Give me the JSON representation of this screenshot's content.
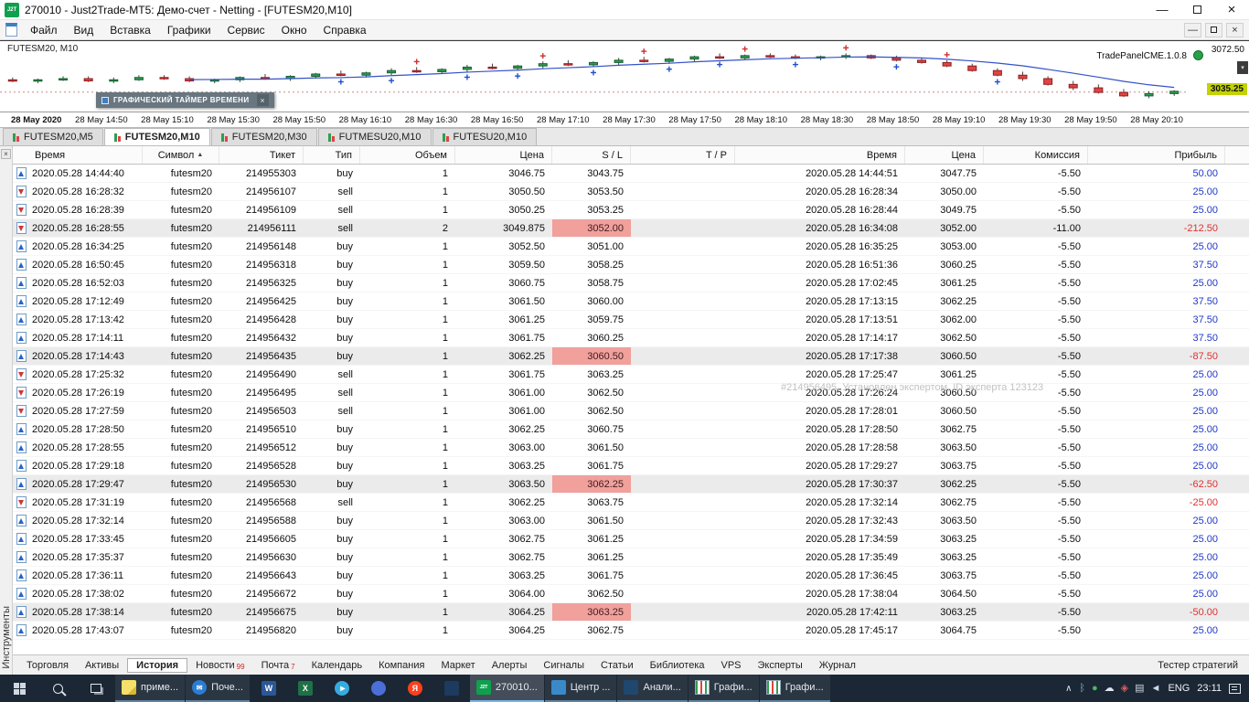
{
  "glyphs": {
    "minimize": "—",
    "close": "×",
    "chevron": "∧",
    "corner_arrow": "▾"
  },
  "titlebar": {
    "icon_text": "J2T",
    "title": "270010 - Just2Trade-MT5: Демо-счет - Netting - [FUTESM20,M10]"
  },
  "menu": {
    "items": [
      "Файл",
      "Вид",
      "Вставка",
      "Графики",
      "Сервис",
      "Окно",
      "Справка"
    ]
  },
  "chart": {
    "symbol_label": "FUTESM20, M10",
    "trade_panel_label": "TradePanelCME.1.0.8",
    "price_axis_top": "3072.50",
    "price_current": "3035.25",
    "timer_overlay_title": "ГРАФИЧЕСКИЙ ТАЙМЕР ВРЕМЕНИ"
  },
  "chart_data": {
    "type": "candlestick",
    "title": "FUTESM20, M10",
    "timeframe": "M10",
    "ylim": [
      3020,
      3078
    ],
    "current_price": 3035.25,
    "visible_axis_prices": [
      3072.5,
      3035.25
    ],
    "ma_period": 8,
    "x_labels": [
      "28 May 2020",
      "28 May 14:50",
      "28 May 15:10",
      "28 May 15:30",
      "28 May 15:50",
      "28 May 16:10",
      "28 May 16:30",
      "28 May 16:50",
      "28 May 17:10",
      "28 May 17:30",
      "28 May 17:50",
      "28 May 18:10",
      "28 May 18:30",
      "28 May 18:50",
      "28 May 19:10",
      "28 May 19:30",
      "28 May 19:50",
      "28 May 20:10"
    ],
    "candles": [
      [
        3046,
        3048,
        3044,
        3045
      ],
      [
        3045,
        3047,
        3043,
        3046
      ],
      [
        3046,
        3049,
        3045,
        3047
      ],
      [
        3047,
        3049,
        3044,
        3045
      ],
      [
        3045,
        3048,
        3043,
        3046
      ],
      [
        3046,
        3050,
        3045,
        3048
      ],
      [
        3048,
        3050,
        3046,
        3047
      ],
      [
        3047,
        3049,
        3044,
        3045
      ],
      [
        3045,
        3047,
        3043,
        3046
      ],
      [
        3046,
        3049,
        3044,
        3048
      ],
      [
        3048,
        3051,
        3046,
        3047
      ],
      [
        3047,
        3050,
        3045,
        3049
      ],
      [
        3049,
        3052,
        3047,
        3051
      ],
      [
        3051,
        3054,
        3049,
        3050
      ],
      [
        3050,
        3053,
        3048,
        3052
      ],
      [
        3052,
        3056,
        3050,
        3054
      ],
      [
        3054,
        3057,
        3052,
        3053
      ],
      [
        3053,
        3056,
        3051,
        3055
      ],
      [
        3055,
        3059,
        3053,
        3057
      ],
      [
        3057,
        3060,
        3055,
        3056
      ],
      [
        3056,
        3059,
        3054,
        3058
      ],
      [
        3058,
        3062,
        3056,
        3060
      ],
      [
        3060,
        3063,
        3058,
        3059
      ],
      [
        3059,
        3062,
        3057,
        3061
      ],
      [
        3061,
        3065,
        3059,
        3063
      ],
      [
        3063,
        3066,
        3061,
        3062
      ],
      [
        3062,
        3065,
        3060,
        3064
      ],
      [
        3064,
        3067,
        3062,
        3066
      ],
      [
        3066,
        3069,
        3064,
        3065
      ],
      [
        3065,
        3068,
        3063,
        3067
      ],
      [
        3067,
        3069,
        3065,
        3066
      ],
      [
        3066,
        3068,
        3064,
        3065
      ],
      [
        3065,
        3067,
        3063,
        3066
      ],
      [
        3066,
        3069,
        3064,
        3067
      ],
      [
        3067,
        3068,
        3064,
        3065
      ],
      [
        3065,
        3067,
        3062,
        3063
      ],
      [
        3063,
        3065,
        3060,
        3061
      ],
      [
        3061,
        3063,
        3057,
        3058
      ],
      [
        3058,
        3060,
        3053,
        3054
      ],
      [
        3054,
        3056,
        3049,
        3050
      ],
      [
        3050,
        3053,
        3045,
        3047
      ],
      [
        3047,
        3049,
        3041,
        3042
      ],
      [
        3042,
        3045,
        3037,
        3039
      ],
      [
        3039,
        3042,
        3034,
        3035
      ],
      [
        3035,
        3038,
        3031,
        3032
      ],
      [
        3032,
        3036,
        3030,
        3034
      ],
      [
        3034,
        3037,
        3032,
        3036
      ]
    ],
    "trade_markers": [
      {
        "i": 13,
        "pos": "below",
        "color": "#2050d0"
      },
      {
        "i": 15,
        "pos": "below",
        "color": "#2050d0"
      },
      {
        "i": 16,
        "pos": "above",
        "color": "#d03030"
      },
      {
        "i": 18,
        "pos": "below",
        "color": "#2050d0"
      },
      {
        "i": 20,
        "pos": "below",
        "color": "#2050d0"
      },
      {
        "i": 21,
        "pos": "above",
        "color": "#d03030"
      },
      {
        "i": 23,
        "pos": "below",
        "color": "#2050d0"
      },
      {
        "i": 25,
        "pos": "above",
        "color": "#d03030"
      },
      {
        "i": 26,
        "pos": "below",
        "color": "#2050d0"
      },
      {
        "i": 28,
        "pos": "below",
        "color": "#2050d0"
      },
      {
        "i": 29,
        "pos": "above",
        "color": "#d03030"
      },
      {
        "i": 31,
        "pos": "below",
        "color": "#2050d0"
      },
      {
        "i": 33,
        "pos": "above",
        "color": "#d03030"
      },
      {
        "i": 35,
        "pos": "below",
        "color": "#2050d0"
      },
      {
        "i": 37,
        "pos": "above",
        "color": "#d03030"
      },
      {
        "i": 39,
        "pos": "below",
        "color": "#2050d0"
      }
    ],
    "colors": {
      "up": "#2e9e52",
      "down": "#e14343",
      "ma_line": "#3452c8"
    }
  },
  "chart_tabs": [
    {
      "label": "FUTESM20,M5",
      "active": false
    },
    {
      "label": "FUTESM20,M10",
      "active": true
    },
    {
      "label": "FUTESM20,M30",
      "active": false
    },
    {
      "label": "FUTMESU20,M10",
      "active": false
    },
    {
      "label": "FUTESU20,M10",
      "active": false
    }
  ],
  "toolbox": {
    "side_label": "Инструменты",
    "right_label": "Тестер стратегий",
    "watermark": "#214956495, Установлен экспертом, ID эксперта 123123",
    "sort_arrow": "▲",
    "columns": [
      "Время",
      "Символ",
      "Тикет",
      "Тип",
      "Объем",
      "Цена",
      "S / L",
      "T / P",
      "Время",
      "Цена",
      "Комиссия",
      "Прибыль"
    ],
    "rows": [
      {
        "t1": "2020.05.28 14:44:40",
        "sym": "futesm20",
        "ticket": "214955303",
        "type": "buy",
        "vol": "1",
        "price": "3046.75",
        "sl": "3043.75",
        "tp": "",
        "t2": "2020.05.28 14:44:51",
        "price2": "3047.75",
        "comm": "-5.50",
        "profit": "50.00",
        "sl_hit": false
      },
      {
        "t1": "2020.05.28 16:28:32",
        "sym": "futesm20",
        "ticket": "214956107",
        "type": "sell",
        "vol": "1",
        "price": "3050.50",
        "sl": "3053.50",
        "tp": "",
        "t2": "2020.05.28 16:28:34",
        "price2": "3050.00",
        "comm": "-5.50",
        "profit": "25.00",
        "sl_hit": false
      },
      {
        "t1": "2020.05.28 16:28:39",
        "sym": "futesm20",
        "ticket": "214956109",
        "type": "sell",
        "vol": "1",
        "price": "3050.25",
        "sl": "3053.25",
        "tp": "",
        "t2": "2020.05.28 16:28:44",
        "price2": "3049.75",
        "comm": "-5.50",
        "profit": "25.00",
        "sl_hit": false
      },
      {
        "t1": "2020.05.28 16:28:55",
        "sym": "futesm20",
        "ticket": "214956111",
        "type": "sell",
        "vol": "2",
        "price": "3049.875",
        "sl": "3052.00",
        "tp": "",
        "t2": "2020.05.28 16:34:08",
        "price2": "3052.00",
        "comm": "-11.00",
        "profit": "-212.50",
        "sl_hit": true
      },
      {
        "t1": "2020.05.28 16:34:25",
        "sym": "futesm20",
        "ticket": "214956148",
        "type": "buy",
        "vol": "1",
        "price": "3052.50",
        "sl": "3051.00",
        "tp": "",
        "t2": "2020.05.28 16:35:25",
        "price2": "3053.00",
        "comm": "-5.50",
        "profit": "25.00",
        "sl_hit": false
      },
      {
        "t1": "2020.05.28 16:50:45",
        "sym": "futesm20",
        "ticket": "214956318",
        "type": "buy",
        "vol": "1",
        "price": "3059.50",
        "sl": "3058.25",
        "tp": "",
        "t2": "2020.05.28 16:51:36",
        "price2": "3060.25",
        "comm": "-5.50",
        "profit": "37.50",
        "sl_hit": false
      },
      {
        "t1": "2020.05.28 16:52:03",
        "sym": "futesm20",
        "ticket": "214956325",
        "type": "buy",
        "vol": "1",
        "price": "3060.75",
        "sl": "3058.75",
        "tp": "",
        "t2": "2020.05.28 17:02:45",
        "price2": "3061.25",
        "comm": "-5.50",
        "profit": "25.00",
        "sl_hit": false
      },
      {
        "t1": "2020.05.28 17:12:49",
        "sym": "futesm20",
        "ticket": "214956425",
        "type": "buy",
        "vol": "1",
        "price": "3061.50",
        "sl": "3060.00",
        "tp": "",
        "t2": "2020.05.28 17:13:15",
        "price2": "3062.25",
        "comm": "-5.50",
        "profit": "37.50",
        "sl_hit": false
      },
      {
        "t1": "2020.05.28 17:13:42",
        "sym": "futesm20",
        "ticket": "214956428",
        "type": "buy",
        "vol": "1",
        "price": "3061.25",
        "sl": "3059.75",
        "tp": "",
        "t2": "2020.05.28 17:13:51",
        "price2": "3062.00",
        "comm": "-5.50",
        "profit": "37.50",
        "sl_hit": false
      },
      {
        "t1": "2020.05.28 17:14:11",
        "sym": "futesm20",
        "ticket": "214956432",
        "type": "buy",
        "vol": "1",
        "price": "3061.75",
        "sl": "3060.25",
        "tp": "",
        "t2": "2020.05.28 17:14:17",
        "price2": "3062.50",
        "comm": "-5.50",
        "profit": "37.50",
        "sl_hit": false
      },
      {
        "t1": "2020.05.28 17:14:43",
        "sym": "futesm20",
        "ticket": "214956435",
        "type": "buy",
        "vol": "1",
        "price": "3062.25",
        "sl": "3060.50",
        "tp": "",
        "t2": "2020.05.28 17:17:38",
        "price2": "3060.50",
        "comm": "-5.50",
        "profit": "-87.50",
        "sl_hit": true
      },
      {
        "t1": "2020.05.28 17:25:32",
        "sym": "futesm20",
        "ticket": "214956490",
        "type": "sell",
        "vol": "1",
        "price": "3061.75",
        "sl": "3063.25",
        "tp": "",
        "t2": "2020.05.28 17:25:47",
        "price2": "3061.25",
        "comm": "-5.50",
        "profit": "25.00",
        "sl_hit": false
      },
      {
        "t1": "2020.05.28 17:26:19",
        "sym": "futesm20",
        "ticket": "214956495",
        "type": "sell",
        "vol": "1",
        "price": "3061.00",
        "sl": "3062.50",
        "tp": "",
        "t2": "2020.05.28 17:26:24",
        "price2": "3060.50",
        "comm": "-5.50",
        "profit": "25.00",
        "sl_hit": false
      },
      {
        "t1": "2020.05.28 17:27:59",
        "sym": "futesm20",
        "ticket": "214956503",
        "type": "sell",
        "vol": "1",
        "price": "3061.00",
        "sl": "3062.50",
        "tp": "",
        "t2": "2020.05.28 17:28:01",
        "price2": "3060.50",
        "comm": "-5.50",
        "profit": "25.00",
        "sl_hit": false
      },
      {
        "t1": "2020.05.28 17:28:50",
        "sym": "futesm20",
        "ticket": "214956510",
        "type": "buy",
        "vol": "1",
        "price": "3062.25",
        "sl": "3060.75",
        "tp": "",
        "t2": "2020.05.28 17:28:50",
        "price2": "3062.75",
        "comm": "-5.50",
        "profit": "25.00",
        "sl_hit": false
      },
      {
        "t1": "2020.05.28 17:28:55",
        "sym": "futesm20",
        "ticket": "214956512",
        "type": "buy",
        "vol": "1",
        "price": "3063.00",
        "sl": "3061.50",
        "tp": "",
        "t2": "2020.05.28 17:28:58",
        "price2": "3063.50",
        "comm": "-5.50",
        "profit": "25.00",
        "sl_hit": false
      },
      {
        "t1": "2020.05.28 17:29:18",
        "sym": "futesm20",
        "ticket": "214956528",
        "type": "buy",
        "vol": "1",
        "price": "3063.25",
        "sl": "3061.75",
        "tp": "",
        "t2": "2020.05.28 17:29:27",
        "price2": "3063.75",
        "comm": "-5.50",
        "profit": "25.00",
        "sl_hit": false
      },
      {
        "t1": "2020.05.28 17:29:47",
        "sym": "futesm20",
        "ticket": "214956530",
        "type": "buy",
        "vol": "1",
        "price": "3063.50",
        "sl": "3062.25",
        "tp": "",
        "t2": "2020.05.28 17:30:37",
        "price2": "3062.25",
        "comm": "-5.50",
        "profit": "-62.50",
        "sl_hit": true
      },
      {
        "t1": "2020.05.28 17:31:19",
        "sym": "futesm20",
        "ticket": "214956568",
        "type": "sell",
        "vol": "1",
        "price": "3062.25",
        "sl": "3063.75",
        "tp": "",
        "t2": "2020.05.28 17:32:14",
        "price2": "3062.75",
        "comm": "-5.50",
        "profit": "-25.00",
        "sl_hit": false
      },
      {
        "t1": "2020.05.28 17:32:14",
        "sym": "futesm20",
        "ticket": "214956588",
        "type": "buy",
        "vol": "1",
        "price": "3063.00",
        "sl": "3061.50",
        "tp": "",
        "t2": "2020.05.28 17:32:43",
        "price2": "3063.50",
        "comm": "-5.50",
        "profit": "25.00",
        "sl_hit": false
      },
      {
        "t1": "2020.05.28 17:33:45",
        "sym": "futesm20",
        "ticket": "214956605",
        "type": "buy",
        "vol": "1",
        "price": "3062.75",
        "sl": "3061.25",
        "tp": "",
        "t2": "2020.05.28 17:34:59",
        "price2": "3063.25",
        "comm": "-5.50",
        "profit": "25.00",
        "sl_hit": false
      },
      {
        "t1": "2020.05.28 17:35:37",
        "sym": "futesm20",
        "ticket": "214956630",
        "type": "buy",
        "vol": "1",
        "price": "3062.75",
        "sl": "3061.25",
        "tp": "",
        "t2": "2020.05.28 17:35:49",
        "price2": "3063.25",
        "comm": "-5.50",
        "profit": "25.00",
        "sl_hit": false
      },
      {
        "t1": "2020.05.28 17:36:11",
        "sym": "futesm20",
        "ticket": "214956643",
        "type": "buy",
        "vol": "1",
        "price": "3063.25",
        "sl": "3061.75",
        "tp": "",
        "t2": "2020.05.28 17:36:45",
        "price2": "3063.75",
        "comm": "-5.50",
        "profit": "25.00",
        "sl_hit": false
      },
      {
        "t1": "2020.05.28 17:38:02",
        "sym": "futesm20",
        "ticket": "214956672",
        "type": "buy",
        "vol": "1",
        "price": "3064.00",
        "sl": "3062.50",
        "tp": "",
        "t2": "2020.05.28 17:38:04",
        "price2": "3064.50",
        "comm": "-5.50",
        "profit": "25.00",
        "sl_hit": false
      },
      {
        "t1": "2020.05.28 17:38:14",
        "sym": "futesm20",
        "ticket": "214956675",
        "type": "buy",
        "vol": "1",
        "price": "3064.25",
        "sl": "3063.25",
        "tp": "",
        "t2": "2020.05.28 17:42:11",
        "price2": "3063.25",
        "comm": "-5.50",
        "profit": "-50.00",
        "sl_hit": true
      },
      {
        "t1": "2020.05.28 17:43:07",
        "sym": "futesm20",
        "ticket": "214956820",
        "type": "buy",
        "vol": "1",
        "price": "3064.25",
        "sl": "3062.75",
        "tp": "",
        "t2": "2020.05.28 17:45:17",
        "price2": "3064.75",
        "comm": "-5.50",
        "profit": "25.00",
        "sl_hit": false
      }
    ],
    "tabs": [
      {
        "label": "Торговля"
      },
      {
        "label": "Активы"
      },
      {
        "label": "История",
        "active": true
      },
      {
        "label": "Новости",
        "badge": "99"
      },
      {
        "label": "Почта",
        "badge": "7"
      },
      {
        "label": "Календарь"
      },
      {
        "label": "Компания"
      },
      {
        "label": "Маркет"
      },
      {
        "label": "Алерты"
      },
      {
        "label": "Сигналы"
      },
      {
        "label": "Статьи"
      },
      {
        "label": "Библиотека"
      },
      {
        "label": "VPS"
      },
      {
        "label": "Эксперты"
      },
      {
        "label": "Журнал"
      }
    ]
  },
  "taskbar": {
    "items": [
      {
        "icon": "sticky",
        "label": "приме...",
        "window": true
      },
      {
        "icon": "mail",
        "glyph": "✉",
        "label": "Поче...",
        "window": true
      },
      {
        "icon": "word",
        "glyph": "W"
      },
      {
        "icon": "excel",
        "glyph": "X"
      },
      {
        "icon": "telegram",
        "glyph": "▸"
      },
      {
        "icon": "app-blue",
        "glyph": ""
      },
      {
        "icon": "yandex",
        "glyph": "Я"
      },
      {
        "icon": "app-dark",
        "glyph": ""
      },
      {
        "icon": "j2t",
        "glyph": "J2T",
        "label": "270010...",
        "window": true,
        "active": true
      },
      {
        "icon": "center",
        "glyph": "",
        " label": "",
        "label": "Центр ...",
        "window": true
      },
      {
        "icon": "analytics",
        "glyph": "",
        "label": "Анали...",
        "window": true
      },
      {
        "icon": "chart",
        "glyph": "",
        "label": "Графи...",
        "window": true
      },
      {
        "icon": "chart",
        "glyph": "",
        "label": "Графи...",
        "window": true
      }
    ],
    "tray": {
      "chevron": "∧",
      "icons": [
        {
          "glyph": "ᛒ",
          "color": "#7fb4e8"
        },
        {
          "glyph": "●",
          "color": "#49b860"
        },
        {
          "glyph": "☁",
          "color": "#dfe6ec"
        },
        {
          "glyph": "◈",
          "color": "#e25b5b"
        },
        {
          "glyph": "▤",
          "color": "#cfd8e0"
        },
        {
          "glyph": "◄",
          "color": "#cfd8e0"
        }
      ],
      "lang": "ENG",
      "time": "23:11"
    }
  }
}
